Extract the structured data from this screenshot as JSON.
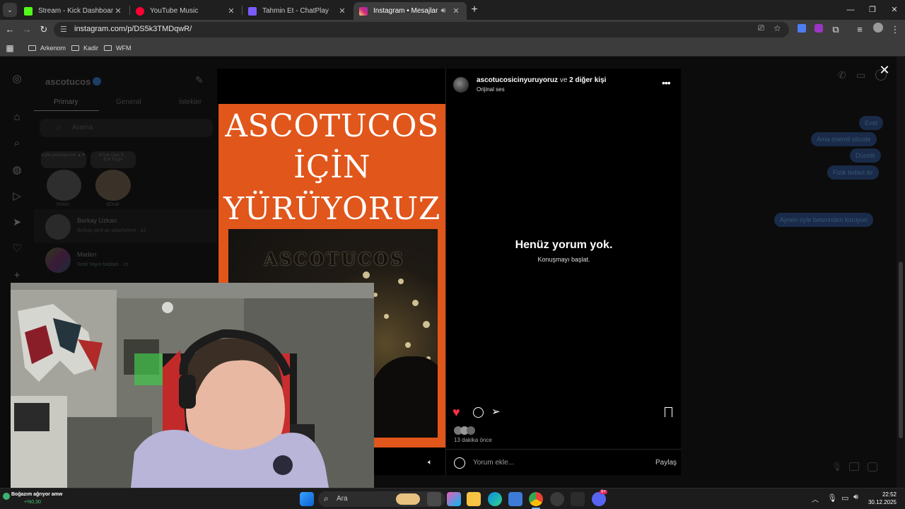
{
  "browser": {
    "tabs": [
      {
        "title": "Stream - Kick Dashboard",
        "fav_color": "#53fc18"
      },
      {
        "title": "YouTube Music",
        "fav_color": "#ff0033"
      },
      {
        "title": "Tahmin Et - ChatPlay",
        "fav_color": "#7b5cff"
      },
      {
        "title": "Instagram • Mesajlar",
        "fav_color": "#e1306c"
      }
    ],
    "url": "instagram.com/p/DS5k3TMDqwR/",
    "bookmarks": [
      "Arkenom",
      "Kadir",
      "WFM"
    ]
  },
  "instagram": {
    "username": "ascotucos",
    "tabs": [
      "Primary",
      "General",
      "İstekler"
    ],
    "search_placeholder": "Arama",
    "notes": [
      {
        "note": "Kafa yeremiyorum ▲▼",
        "name": "Notun"
      },
      {
        "note": "Ill İsle Oyle B...\nEnir Evgin",
        "name": "dDruk"
      }
    ],
    "chats": [
      {
        "name": "Berkay Uzkan",
        "preview": "Berkay sent an attachment · 1d"
      },
      {
        "name": "Maden",
        "preview": "Sesli Yayın başladı · 1s"
      }
    ],
    "messages": [
      "Evet",
      "Ama onemli olcude",
      "Düzelir",
      "Fizik tedavi ile",
      "Aynen oyle beterinden koruyun"
    ]
  },
  "post": {
    "poster_lines": [
      "ASCOTUCOS",
      "İÇİN",
      "YÜRÜYORUZ"
    ],
    "photo_text": "ASCOTUCOS",
    "author": "ascotucosicinyuruyoruz",
    "author_suffix": "ve",
    "others": "2 diğer kişi",
    "audio": "Orijinal ses",
    "empty_title": "Henüz yorum yok.",
    "empty_sub": "Konuşmayı başlat.",
    "time": "13 dakika önce",
    "comment_placeholder": "Yorum ekle...",
    "share_label": "Paylaş"
  },
  "taskbar": {
    "search_label": "Ara",
    "ticker_text": "Boğazım ağrıyor amw",
    "ticker_value": "+%0,30",
    "time": "22:52",
    "date": "30.12.2025",
    "discord_badge": "9+"
  }
}
